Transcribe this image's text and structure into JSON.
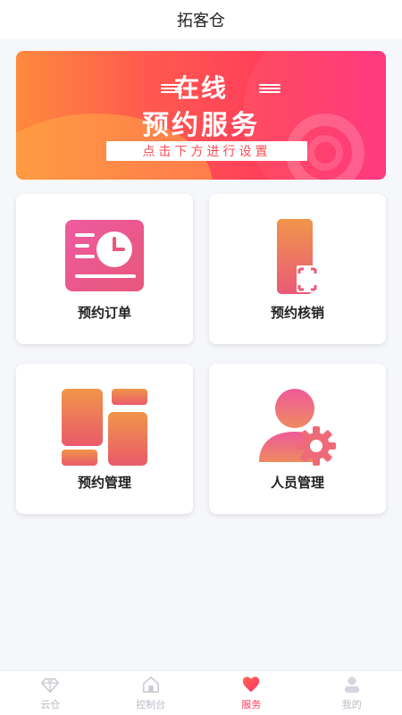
{
  "header": {
    "title": "拓客仓"
  },
  "banner": {
    "line1": "在线",
    "line2": "预约服务",
    "strip": "点击下方进行设置"
  },
  "cards": [
    {
      "label": "预约订单",
      "icon": "calendar-order-icon"
    },
    {
      "label": "预约核销",
      "icon": "phone-scan-icon"
    },
    {
      "label": "预约管理",
      "icon": "layout-grid-icon"
    },
    {
      "label": "人员管理",
      "icon": "user-gear-icon"
    }
  ],
  "tabbar": {
    "items": [
      {
        "label": "云仓",
        "icon": "diamond-icon",
        "active": false
      },
      {
        "label": "控制台",
        "icon": "home-icon",
        "active": false
      },
      {
        "label": "服务",
        "icon": "heart-icon",
        "active": true
      },
      {
        "label": "我的",
        "icon": "person-icon",
        "active": false
      }
    ]
  },
  "colors": {
    "accent": "#ff3a5c",
    "icon_gradient_start": "#ee6a9c",
    "icon_gradient_end": "#f29a4a",
    "inactive": "#b8bcc6"
  }
}
